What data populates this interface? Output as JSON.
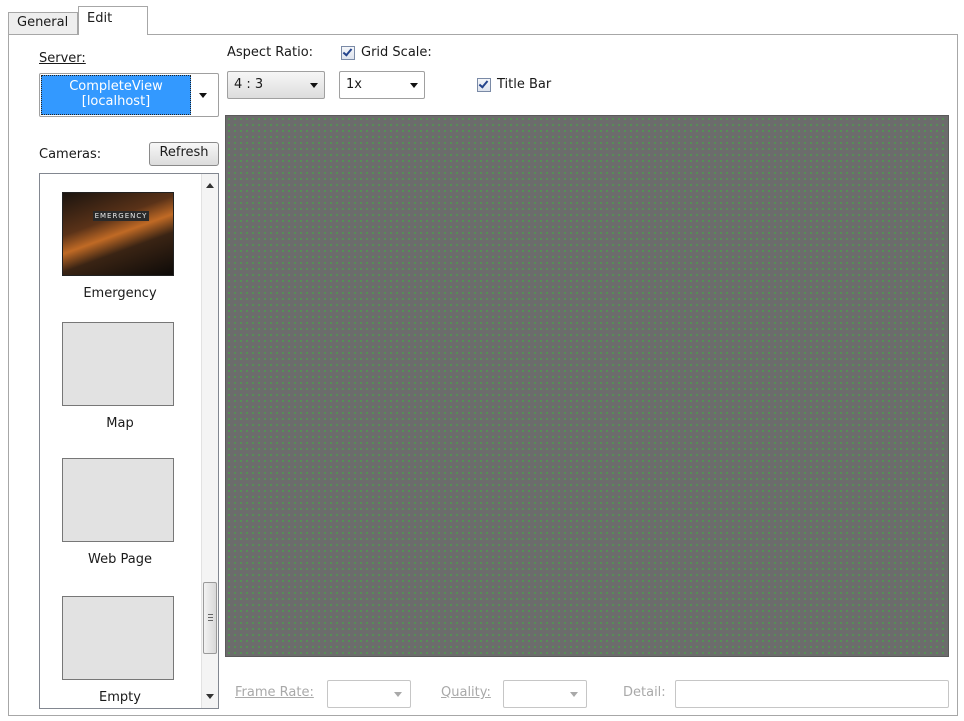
{
  "tabs": [
    {
      "label": "General"
    },
    {
      "label": "Edit"
    }
  ],
  "server": {
    "label": "Server:",
    "selected_line1": "CompleteView",
    "selected_line2": "[localhost]"
  },
  "aspect_ratio": {
    "label": "Aspect Ratio:",
    "value": "4 : 3"
  },
  "grid_scale": {
    "label": "Grid Scale:",
    "checked": true,
    "value": "1x"
  },
  "title_bar": {
    "label": "Title Bar",
    "checked": true
  },
  "cameras": {
    "label": "Cameras:",
    "refresh_label": "Refresh",
    "items": [
      {
        "label": "Emergency",
        "thumb": "video",
        "sign_text": "EMERGENCY"
      },
      {
        "label": "Map",
        "thumb": "blank"
      },
      {
        "label": "Web Page",
        "thumb": "blank"
      },
      {
        "label": "Empty",
        "thumb": "blank"
      }
    ]
  },
  "footer": {
    "frame_rate_label": "Frame Rate:",
    "quality_label": "Quality:",
    "detail_label": "Detail:"
  },
  "colors": {
    "selection": "#3399ff",
    "canvas_bg": "#6c6c6c",
    "grid_dot": "#4f9a4f"
  }
}
